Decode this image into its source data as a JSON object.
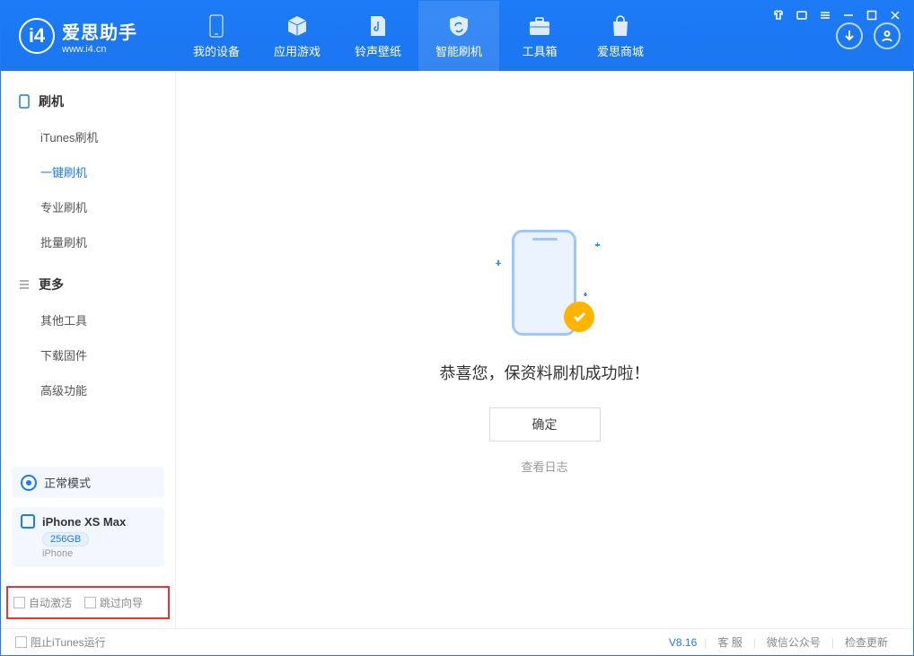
{
  "app": {
    "name": "爱思助手",
    "site": "www.i4.cn"
  },
  "nav": [
    {
      "label": "我的设备"
    },
    {
      "label": "应用游戏"
    },
    {
      "label": "铃声壁纸"
    },
    {
      "label": "智能刷机"
    },
    {
      "label": "工具箱"
    },
    {
      "label": "爱思商城"
    }
  ],
  "sidebar": {
    "group1": {
      "title": "刷机",
      "items": [
        {
          "label": "iTunes刷机"
        },
        {
          "label": "一键刷机"
        },
        {
          "label": "专业刷机"
        },
        {
          "label": "批量刷机"
        }
      ]
    },
    "group2": {
      "title": "更多",
      "items": [
        {
          "label": "其他工具"
        },
        {
          "label": "下载固件"
        },
        {
          "label": "高级功能"
        }
      ]
    }
  },
  "device_panel": {
    "mode_label": "正常模式",
    "device_name": "iPhone XS Max",
    "capacity": "256GB",
    "device_type": "iPhone"
  },
  "options": {
    "auto_activate": "自动激活",
    "skip_guide": "跳过向导"
  },
  "main": {
    "success_message": "恭喜您，保资料刷机成功啦！",
    "ok_button": "确定",
    "view_log": "查看日志"
  },
  "footer": {
    "block_itunes": "阻止iTunes运行",
    "version": "V8.16",
    "support": "客 服",
    "wechat": "微信公众号",
    "check_update": "检查更新"
  }
}
